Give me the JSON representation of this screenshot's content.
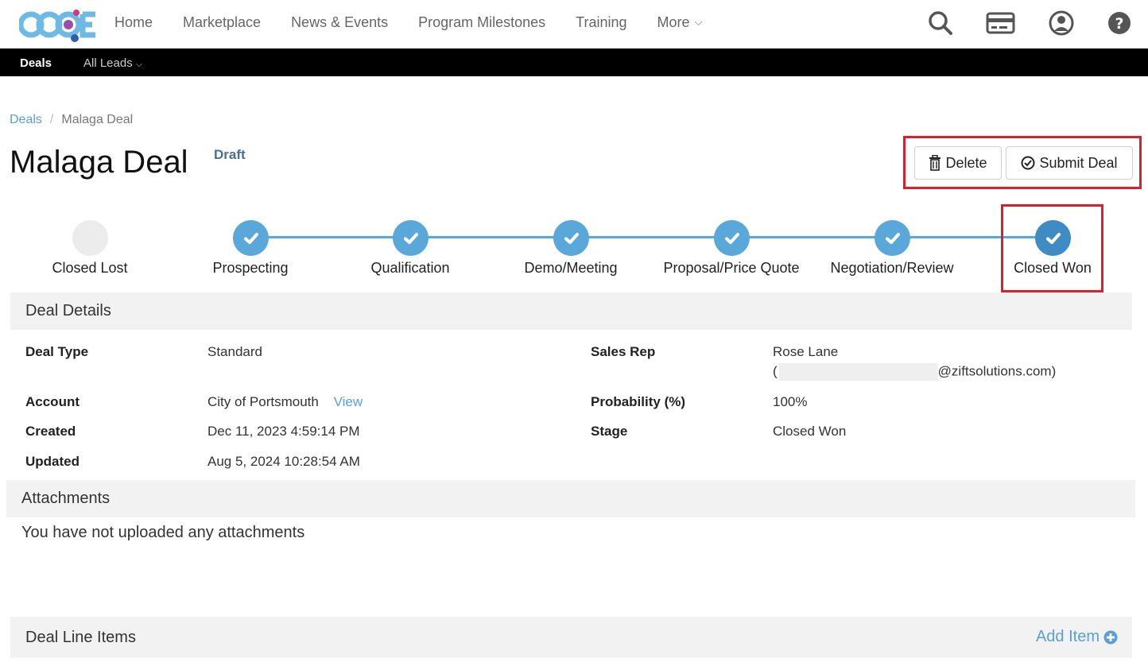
{
  "header": {
    "logo_text": "CCOE",
    "nav": [
      "Home",
      "Marketplace",
      "News & Events",
      "Program Milestones",
      "Training"
    ],
    "more_label": "More"
  },
  "icons": {
    "search": "search-icon",
    "card": "credit-card-icon",
    "user": "user-circle-icon",
    "help": "help-icon"
  },
  "subnav": {
    "deals": "Deals",
    "all_leads": "All Leads"
  },
  "breadcrumb": {
    "root": "Deals",
    "current": "Malaga Deal"
  },
  "deal": {
    "title": "Malaga Deal",
    "status": "Draft"
  },
  "actions": {
    "delete": "Delete",
    "submit": "Submit Deal"
  },
  "stages": [
    {
      "label": "Closed Lost",
      "state": "empty"
    },
    {
      "label": "Prospecting",
      "state": "done"
    },
    {
      "label": "Qualification",
      "state": "done"
    },
    {
      "label": "Demo/Meeting",
      "state": "done"
    },
    {
      "label": "Proposal/Price Quote",
      "state": "done"
    },
    {
      "label": "Negotiation/Review",
      "state": "done"
    },
    {
      "label": "Closed Won",
      "state": "current"
    }
  ],
  "details": {
    "heading": "Deal Details",
    "deal_type_label": "Deal Type",
    "deal_type": "Standard",
    "account_label": "Account",
    "account": "City of Portsmouth",
    "view_link": "View",
    "created_label": "Created",
    "created": "Dec 11, 2023 4:59:14 PM",
    "updated_label": "Updated",
    "updated": "Aug 5, 2024 10:28:54 AM",
    "sales_rep_label": "Sales Rep",
    "sales_rep": "Rose Lane",
    "sales_rep_email_open": "(",
    "sales_rep_email_domain": "@ziftsolutions.com)",
    "probability_label": "Probability (%)",
    "probability": "100%",
    "stage_label": "Stage",
    "stage": "Closed Won"
  },
  "attachments": {
    "heading": "Attachments",
    "empty": "You have not uploaded any attachments"
  },
  "line_items": {
    "heading": "Deal Line Items",
    "add_label": "Add Item"
  },
  "colors": {
    "accent": "#5aa8da",
    "current_stage": "#3f8cc4",
    "highlight": "#d9202d",
    "link": "#5aa0d6"
  }
}
